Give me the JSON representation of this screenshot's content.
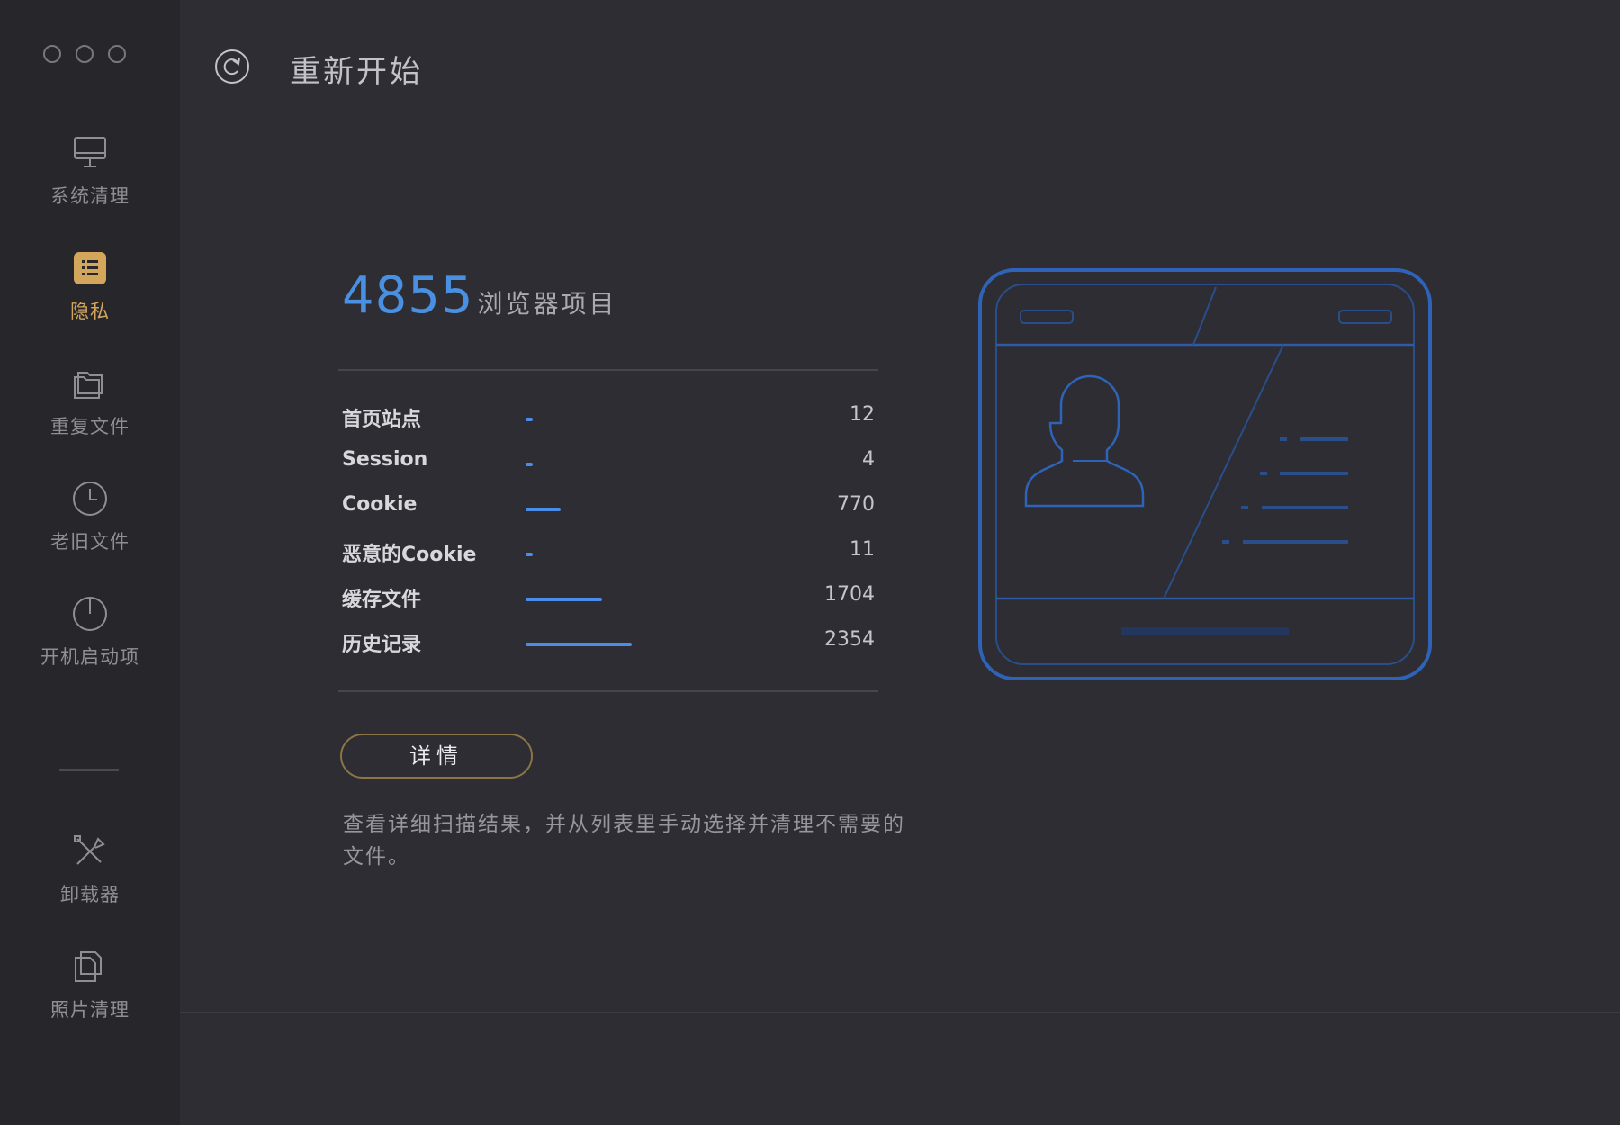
{
  "window": {
    "title": "重新开始"
  },
  "sidebar": {
    "items": [
      {
        "label": "系统清理",
        "icon": "monitor-icon",
        "active": false
      },
      {
        "label": "隐私",
        "icon": "privacy-list-icon",
        "active": true
      },
      {
        "label": "重复文件",
        "icon": "folder-icon",
        "active": false
      },
      {
        "label": "老旧文件",
        "icon": "clock-icon",
        "active": false
      },
      {
        "label": "开机启动项",
        "icon": "power-icon",
        "active": false
      },
      {
        "label": "卸载器",
        "icon": "tools-icon",
        "active": false
      },
      {
        "label": "照片清理",
        "icon": "photos-icon",
        "active": false
      }
    ]
  },
  "header": {
    "restart_label": "重新开始",
    "restart_icon": "refresh-icon"
  },
  "summary": {
    "total": "4855",
    "unit": "浏览器项目"
  },
  "stats": [
    {
      "name": "首页站点",
      "value": "12",
      "count": 12
    },
    {
      "name": "Session",
      "value": "4",
      "count": 4
    },
    {
      "name": "Cookie",
      "value": "770",
      "count": 770
    },
    {
      "name": "恶意的Cookie",
      "value": "11",
      "count": 11
    },
    {
      "name": "缓存文件",
      "value": "1704",
      "count": 1704
    },
    {
      "name": "历史记录",
      "value": "2354",
      "count": 2354
    }
  ],
  "actions": {
    "details_label": "详情"
  },
  "description": "查看详细扫描结果，并从列表里手动选择并清理不需要的文件。",
  "illustration": {
    "icon": "browser-id-card-icon"
  },
  "colors": {
    "accent": "#4a90e2",
    "active": "#d3a65c",
    "bar": "#4a8eea",
    "button_border": "#8b7546"
  }
}
